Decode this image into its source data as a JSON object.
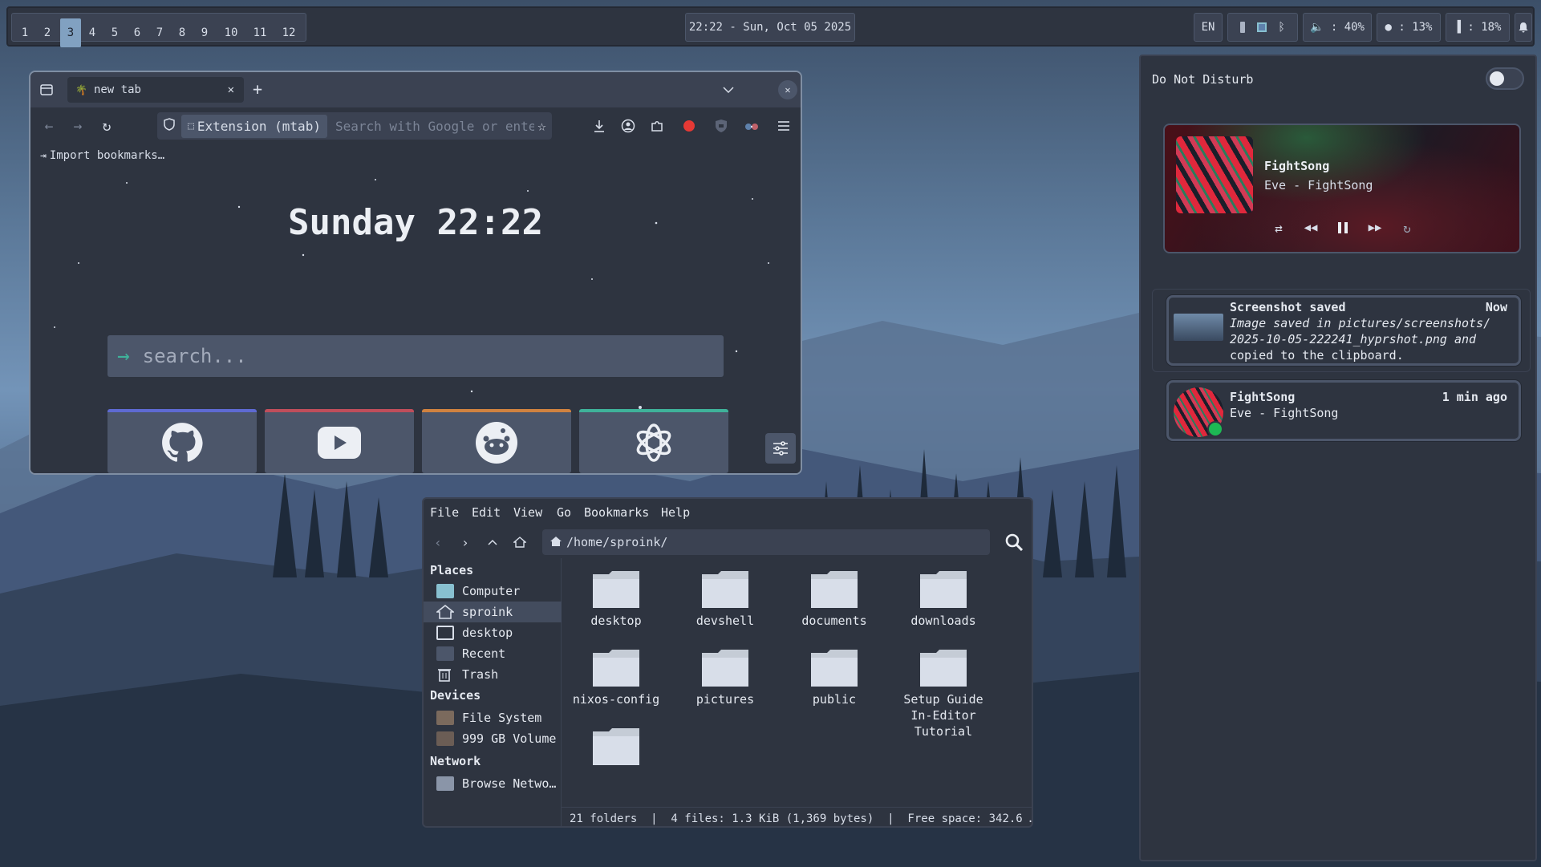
{
  "topbar": {
    "workspaces": [
      "1",
      "2",
      "3",
      "4",
      "5",
      "6",
      "7",
      "8",
      "9",
      "10",
      "11",
      "12"
    ],
    "active_workspace": "3",
    "clock": "22:22 - Sun, Oct 05 2025",
    "keyboard_layout": "EN",
    "volume": "🔈 : 40%",
    "cpu": "● : 13%",
    "memory": "▐ : 18%"
  },
  "browser": {
    "tab_title": "new tab",
    "url_badge": "Extension (mtab)",
    "url_placeholder": "Search with Google or enter address",
    "bookmarks_import": "Import bookmarks…",
    "greeting": "Sunday 22:22",
    "search_placeholder": "search...",
    "tiles": [
      {
        "name": "github",
        "accent": "#5e6ad2"
      },
      {
        "name": "youtube",
        "accent": "#bf4e5b"
      },
      {
        "name": "reddit",
        "accent": "#d08240"
      },
      {
        "name": "chatgpt",
        "accent": "#3fb29a"
      }
    ]
  },
  "filemanager": {
    "menu": [
      "File",
      "Edit",
      "View",
      "Go",
      "Bookmarks",
      "Help"
    ],
    "path": "/home/sproink/",
    "sidebar": {
      "places_heading": "Places",
      "places": [
        "Computer",
        "sproink",
        "desktop",
        "Recent",
        "Trash"
      ],
      "devices_heading": "Devices",
      "devices": [
        "File System",
        "999 GB Volume"
      ],
      "network_heading": "Network",
      "network": [
        "Browse Netwo…"
      ]
    },
    "folders": [
      "desktop",
      "devshell",
      "documents",
      "downloads",
      "nixos-config",
      "pictures",
      "public",
      "Setup Guide In-Editor Tutorial",
      ""
    ],
    "status": "21 folders  |  4 files: 1.3 KiB (1,369 bytes)  |  Free space: 342.6 …"
  },
  "panel": {
    "dnd_label": "Do Not Disturb",
    "dnd_enabled": false,
    "player": {
      "title": "FightSong",
      "subtitle": "Eve - FightSong"
    },
    "notifications": [
      {
        "title": "Screenshot saved",
        "time": "Now",
        "line1": "Image saved in pictures/screenshots/",
        "line2": "2025-10-05-222241_hyprshot.png and",
        "line3": "copied to the clipboard."
      },
      {
        "title": "FightSong",
        "time": "1 min ago",
        "line1": "Eve - FightSong"
      }
    ]
  },
  "colors": {
    "bar_bg": "#2e3440",
    "accent": "#81a1c1",
    "panel_bg": "#2e3440"
  }
}
